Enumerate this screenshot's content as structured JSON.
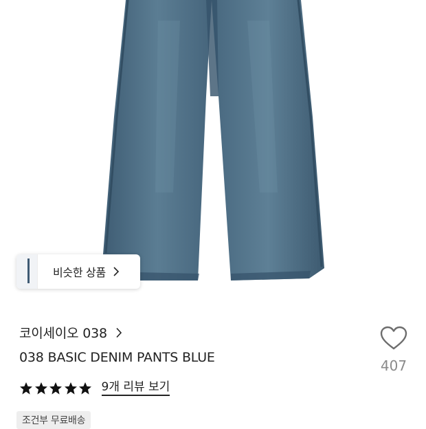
{
  "product_image": {
    "icon": "denim-pants-image",
    "denim_color": "#4f6f86"
  },
  "similar_products": {
    "label": "비슷한 상품",
    "icon": "chevron-right-icon"
  },
  "brand": {
    "name": "코이세이오 038",
    "icon": "chevron-right-icon"
  },
  "product": {
    "name": "038 BASIC DENIM PANTS BLUE"
  },
  "like": {
    "icon": "heart-icon",
    "count": "407"
  },
  "rating": {
    "stars": 5,
    "max_stars": 5,
    "review_link": "9개 리뷰 보기"
  },
  "shipping": {
    "badge": "조건부 무료배송"
  }
}
